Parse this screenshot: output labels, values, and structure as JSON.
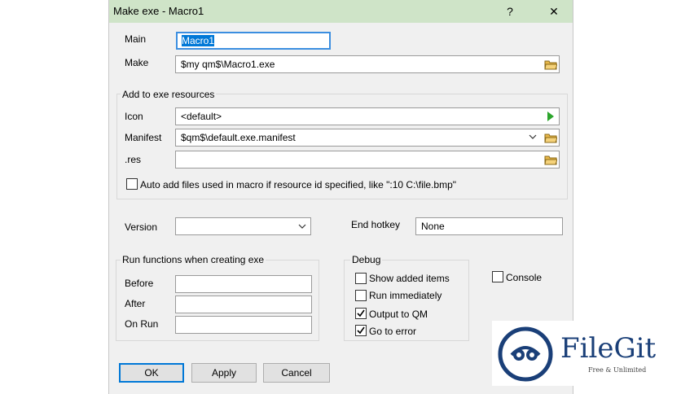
{
  "window": {
    "title": "Make exe - Macro1",
    "help_glyph": "?",
    "close_glyph": "✕"
  },
  "main": {
    "main_label": "Main",
    "main_value": "Macro1",
    "make_label": "Make",
    "make_value": "$my qm$\\Macro1.exe"
  },
  "resources": {
    "title": "Add to exe resources",
    "icon_label": "Icon",
    "icon_value": "<default>",
    "manifest_label": "Manifest",
    "manifest_value": "$qm$\\default.exe.manifest",
    "res_label": ".res",
    "res_value": "",
    "auto_add_label": "Auto add files used in macro if resource id specified, like \":10 C:\\file.bmp\"",
    "auto_add_checked": false
  },
  "version": {
    "label": "Version",
    "value": ""
  },
  "hotkey": {
    "label": "End hotkey",
    "value": "None"
  },
  "run_functions": {
    "title": "Run functions when creating exe",
    "before_label": "Before",
    "before_value": "",
    "after_label": "After",
    "after_value": "",
    "onrun_label": "On Run",
    "onrun_value": ""
  },
  "debug": {
    "title": "Debug",
    "items": [
      {
        "label": "Show added items",
        "checked": false
      },
      {
        "label": "Run immediately",
        "checked": false
      },
      {
        "label": "Output to QM",
        "checked": true
      },
      {
        "label": "Go to error",
        "checked": true
      }
    ]
  },
  "console": {
    "label": "Console",
    "checked": false
  },
  "buttons": {
    "ok": "OK",
    "apply": "Apply",
    "cancel": "Cancel"
  },
  "watermark": {
    "name": "FileGit",
    "tagline": "Free & Unlimited"
  },
  "colors": {
    "titlebar": "#cfe4c8",
    "accent": "#0078d7",
    "selection": "#0078d7",
    "arrow": "#2ca52c",
    "folder": "#e8b84a",
    "logo": "#1a3f78"
  }
}
